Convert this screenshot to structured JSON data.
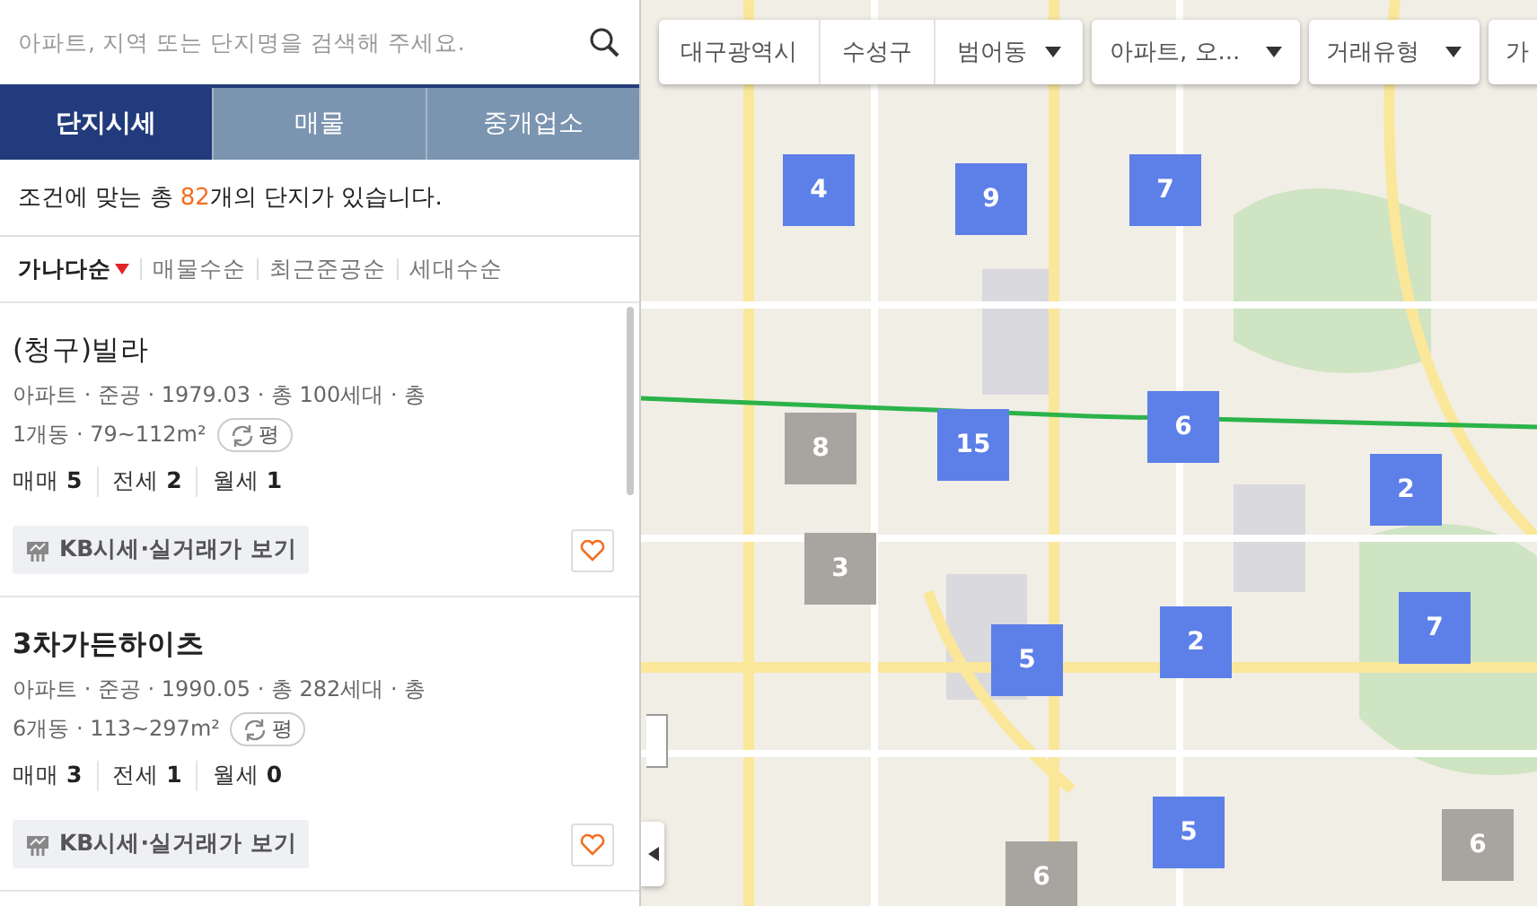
{
  "search": {
    "placeholder": "아파트, 지역 또는 단지명을 검색해 주세요."
  },
  "tabs": [
    {
      "label": "단지시세",
      "selected": true
    },
    {
      "label": "매물",
      "selected": false
    },
    {
      "label": "중개업소",
      "selected": false
    }
  ],
  "result": {
    "before": "조건에 맞는 총 ",
    "count": "82",
    "after": "개의 단지가 있습니다."
  },
  "sort": [
    {
      "label": "가나다순",
      "selected": true
    },
    {
      "label": "매물수순",
      "selected": false
    },
    {
      "label": "최근준공순",
      "selected": false
    },
    {
      "label": "세대수순",
      "selected": false
    }
  ],
  "complexes": [
    {
      "name": "(청구)빌라",
      "info": "아파트 · 준공 · 1979.03 · 총 100세대 · 총",
      "size": "1개동 · 79~112m²",
      "unit": "평",
      "deals": [
        {
          "label": "매매",
          "count": "5"
        },
        {
          "label": "전세",
          "count": "2"
        },
        {
          "label": "월세",
          "count": "1"
        }
      ],
      "kb": "KB시세·실거래가 보기",
      "favorite": false
    },
    {
      "name": "3차가든하이츠",
      "info": "아파트 · 준공 · 1990.05 · 총 282세대 · 총",
      "size": "6개동 · 113~297m²",
      "unit": "평",
      "deals": [
        {
          "label": "매매",
          "count": "3"
        },
        {
          "label": "전세",
          "count": "1"
        },
        {
          "label": "월세",
          "count": "0"
        }
      ],
      "kb": "KB시세·실거래가 보기",
      "favorite": false
    }
  ],
  "breadcrumb": [
    "대구광역시",
    "수성구",
    "범어동"
  ],
  "filters": [
    {
      "label": "아파트, 오...",
      "dropdown": true
    },
    {
      "label": "거래유형",
      "dropdown": true
    },
    {
      "label": "가",
      "dropdown": false
    }
  ],
  "markers": [
    {
      "count": "4",
      "kind": "complex"
    },
    {
      "count": "9",
      "kind": "complex"
    },
    {
      "count": "7",
      "kind": "complex"
    },
    {
      "count": "8",
      "kind": "empty"
    },
    {
      "count": "15",
      "kind": "complex"
    },
    {
      "count": "6",
      "kind": "complex"
    },
    {
      "count": "2",
      "kind": "complex"
    },
    {
      "count": "3",
      "kind": "empty"
    },
    {
      "count": "5",
      "kind": "complex"
    },
    {
      "count": "2",
      "kind": "complex"
    },
    {
      "count": "7",
      "kind": "complex"
    },
    {
      "count": "5",
      "kind": "complex"
    },
    {
      "count": "6",
      "kind": "empty"
    },
    {
      "count": "6",
      "kind": "empty"
    }
  ]
}
